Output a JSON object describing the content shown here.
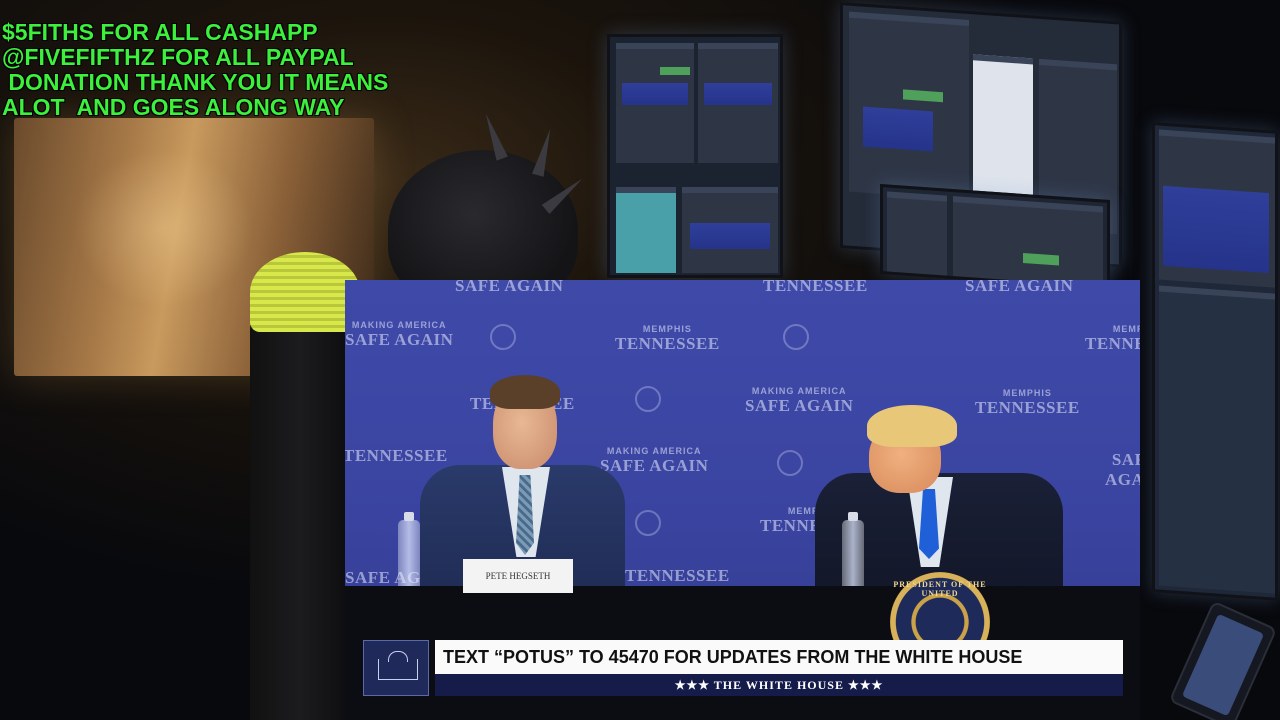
{
  "overlay": {
    "donation_text": "$5FITHS FOR ALL CASHAPP\n@FIVEFIFTHZ FOR ALL PAYPAL\n DONATION THANK YOU IT MEANS\nALOT  AND GOES ALONG WAY"
  },
  "video": {
    "backdrop": {
      "making_america": "MAKING AMERICA",
      "safe_again": "SAFE AGAIN",
      "memphis": "MEMPHIS",
      "tennessee": "TENNESSEE"
    },
    "placard_name": "PETE HEGSETH",
    "seal_text": "PRESIDENT OF THE UNITED",
    "lower_third": {
      "headline": "TEXT “POTUS” TO 45470 FOR UPDATES FROM THE WHITE HOUSE",
      "brand": "★★★  THE WHITE HOUSE  ★★★"
    }
  },
  "colors": {
    "overlay_text": "#3cf03c",
    "backdrop_blue": "#3f49a8",
    "lower_third_bar": "#151c4a"
  }
}
